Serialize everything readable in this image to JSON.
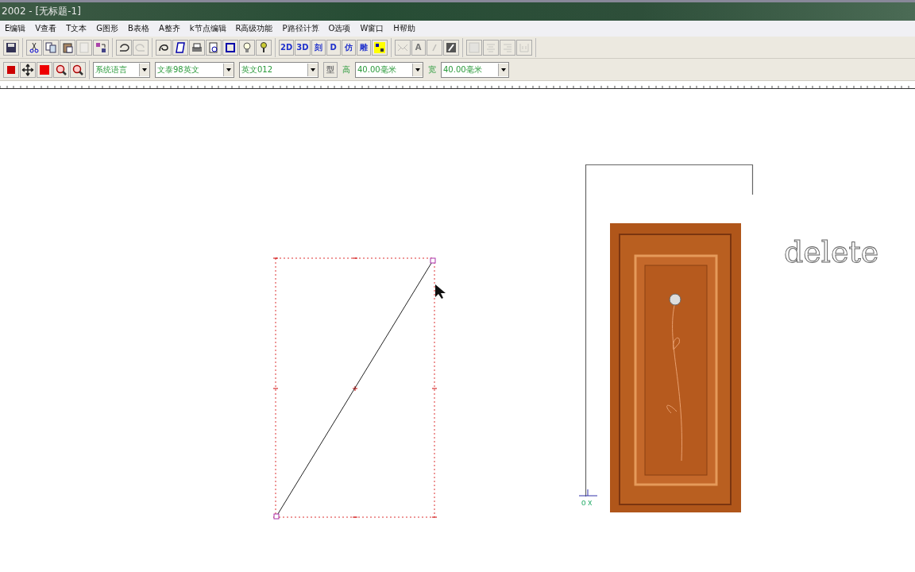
{
  "window": {
    "title": "2002 - [无标题-1]"
  },
  "menu": [
    "E编辑",
    "V查看",
    "T文本",
    "G图形",
    "B表格",
    "A整齐",
    "k节点编辑",
    "R高级功能",
    "P路径计算",
    "O选项",
    "W窗口",
    "H帮助"
  ],
  "toolbar_1": [
    [
      {
        "kind": "save",
        "disabled": false
      }
    ],
    [
      {
        "kind": "scissors",
        "disabled": false
      },
      {
        "kind": "copy",
        "disabled": false
      },
      {
        "kind": "paste",
        "disabled": false
      },
      {
        "kind": "document",
        "disabled": true
      },
      {
        "kind": "swap",
        "disabled": false
      }
    ],
    [
      {
        "kind": "undo",
        "disabled": false
      },
      {
        "kind": "redo",
        "disabled": true
      }
    ],
    [
      {
        "kind": "curve",
        "disabled": false
      },
      {
        "kind": "page",
        "disabled": false
      },
      {
        "kind": "print",
        "disabled": false
      },
      {
        "kind": "preview",
        "disabled": false
      },
      {
        "kind": "frame",
        "disabled": false
      },
      {
        "kind": "bulb",
        "disabled": false
      },
      {
        "kind": "help",
        "disabled": false
      }
    ],
    [
      {
        "kind": "label",
        "label": "2D",
        "disabled": false
      },
      {
        "kind": "label",
        "label": "3D",
        "disabled": false
      },
      {
        "kind": "label",
        "label": "刻",
        "disabled": false
      },
      {
        "kind": "label",
        "label": "D",
        "disabled": false
      },
      {
        "kind": "label",
        "label": "仿",
        "disabled": false
      },
      {
        "kind": "label",
        "label": "雕",
        "disabled": false
      },
      {
        "kind": "squares",
        "disabled": false
      }
    ],
    [
      {
        "kind": "lines",
        "disabled": true
      },
      {
        "kind": "letter",
        "label": "A",
        "disabled": true
      },
      {
        "kind": "slash",
        "disabled": true
      },
      {
        "kind": "pen",
        "disabled": false
      }
    ],
    [
      {
        "kind": "align-left",
        "disabled": true
      },
      {
        "kind": "align-center",
        "disabled": true
      },
      {
        "kind": "align-right",
        "disabled": true
      },
      {
        "kind": "align-bottom",
        "disabled": true
      }
    ]
  ],
  "toolbar_2": {
    "icons": [
      {
        "kind": "node",
        "disabled": false
      },
      {
        "kind": "move",
        "disabled": false
      },
      {
        "kind": "fill",
        "disabled": false
      },
      {
        "kind": "zoom-in",
        "disabled": false
      },
      {
        "kind": "zoom-out",
        "disabled": false
      }
    ],
    "font_language": "系统语言",
    "font_name": "文泰98英文",
    "font_style": "英文012",
    "style_button": {
      "label": "型",
      "disabled": true
    },
    "height_label": "高",
    "height_value": "40.00毫米",
    "width_label": "宽",
    "width_value": "40.00毫米"
  },
  "canvas": {
    "axis_label": "o x",
    "outlined_text": "delete"
  }
}
